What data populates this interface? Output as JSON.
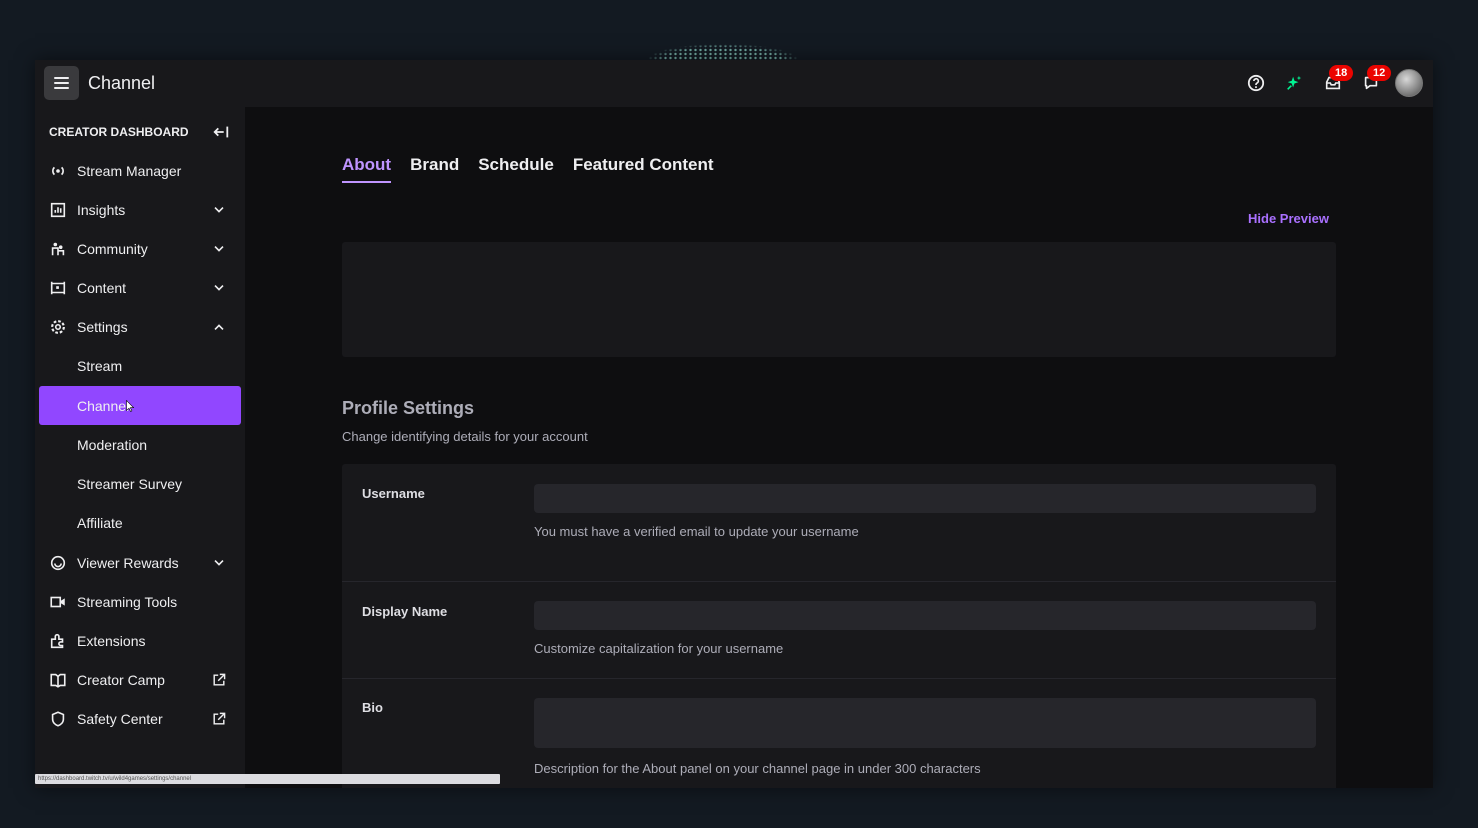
{
  "topbar": {
    "title": "Channel",
    "inbox_count": "18",
    "notification_count": "12"
  },
  "sidebar": {
    "header": "CREATOR DASHBOARD",
    "items": [
      {
        "label": "Stream Manager"
      },
      {
        "label": "Insights"
      },
      {
        "label": "Community"
      },
      {
        "label": "Content"
      },
      {
        "label": "Settings"
      },
      {
        "label": "Stream"
      },
      {
        "label": "Channel"
      },
      {
        "label": "Moderation"
      },
      {
        "label": "Streamer Survey"
      },
      {
        "label": "Affiliate"
      },
      {
        "label": "Viewer Rewards"
      },
      {
        "label": "Streaming Tools"
      },
      {
        "label": "Extensions"
      },
      {
        "label": "Creator Camp"
      },
      {
        "label": "Safety Center"
      }
    ]
  },
  "main": {
    "tabs": [
      {
        "label": "About"
      },
      {
        "label": "Brand"
      },
      {
        "label": "Schedule"
      },
      {
        "label": "Featured Content"
      }
    ],
    "hide_preview": "Hide Preview",
    "profile_title": "Profile Settings",
    "profile_subtitle": "Change identifying details for your account",
    "fields": [
      {
        "label": "Username",
        "value": "",
        "help": "You must have a verified email to update your username"
      },
      {
        "label": "Display Name",
        "value": "",
        "help": "Customize capitalization for your username"
      },
      {
        "label": "Bio",
        "value": "",
        "help": "Description for the About panel on your channel page in under 300 characters"
      }
    ]
  },
  "status_bar": {
    "url": "https://dashboard.twitch.tv/u/wild4games/settings/channel"
  },
  "colors": {
    "accent": "#9147ff",
    "accent_text": "#bf94ff",
    "badge": "#eb0400",
    "background": "#0e0e10",
    "panel": "#18181b"
  }
}
